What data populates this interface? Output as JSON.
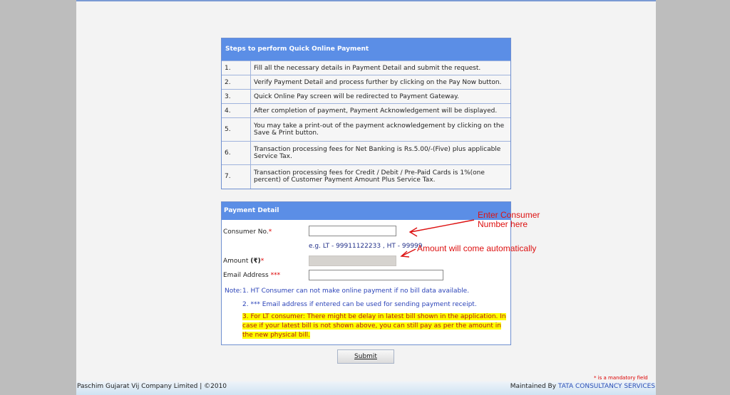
{
  "steps": {
    "title": "Steps to perform Quick Online Payment",
    "rows": [
      {
        "num": "1.",
        "text": "Fill all the necessary details in Payment Detail and submit the request."
      },
      {
        "num": "2.",
        "text": "Verify Payment Detail and process further by clicking on the Pay Now button."
      },
      {
        "num": "3.",
        "text": "Quick Online Pay screen will be redirected to Payment Gateway."
      },
      {
        "num": "4.",
        "text": "After completion of payment, Payment Acknowledgement will be displayed."
      },
      {
        "num": "5.",
        "text": "You may take a print-out of the payment acknowledgement by clicking on the Save & Print button."
      },
      {
        "num": "6.",
        "text": "Transaction processing fees for Net Banking is Rs.5.00/-(Five) plus applicable Service Tax."
      },
      {
        "num": "7.",
        "text": "Transaction processing fees for Credit / Debit / Pre-Paid Cards is 1%(one percent) of Customer Payment Amount Plus Service Tax."
      }
    ]
  },
  "payment": {
    "title": "Payment Detail",
    "consumer_label": "Consumer No.",
    "consumer_value": "",
    "example": "e.g. LT - 99911122233 , HT - 99999",
    "amount_label": "Amount",
    "amount_symbol": "(₹)",
    "amount_value": "",
    "email_label": "Email Address",
    "email_mark": "***",
    "email_value": "",
    "asterisk": "*",
    "note_prefix": "Note:",
    "note1": "1. HT Consumer can not make online payment if no bill data available.",
    "note2": "2. *** Email address if entered can be used for sending payment receipt.",
    "note3": "3. For LT consumer: There might be delay in latest bill shown in the application. In case if your latest bill is not shown above, you can still pay as per the amount in the new physical bill."
  },
  "submit_label": "Submit",
  "mandatory": "* is a mandatory field",
  "footer": {
    "left": "Paschim Gujarat Vij Company Limited | ©2010",
    "right_prefix": "Maintained By",
    "right_company": "TATA CONSULTANCY SERVICES"
  },
  "annotations": {
    "consumer_line1": "Enter Consumer",
    "consumer_line2": "Number here",
    "amount": "Amount will come automatically"
  },
  "colors": {
    "header_blue": "#5b8ee6",
    "annotation_red": "#dd1111",
    "highlight": "#ffff00"
  }
}
